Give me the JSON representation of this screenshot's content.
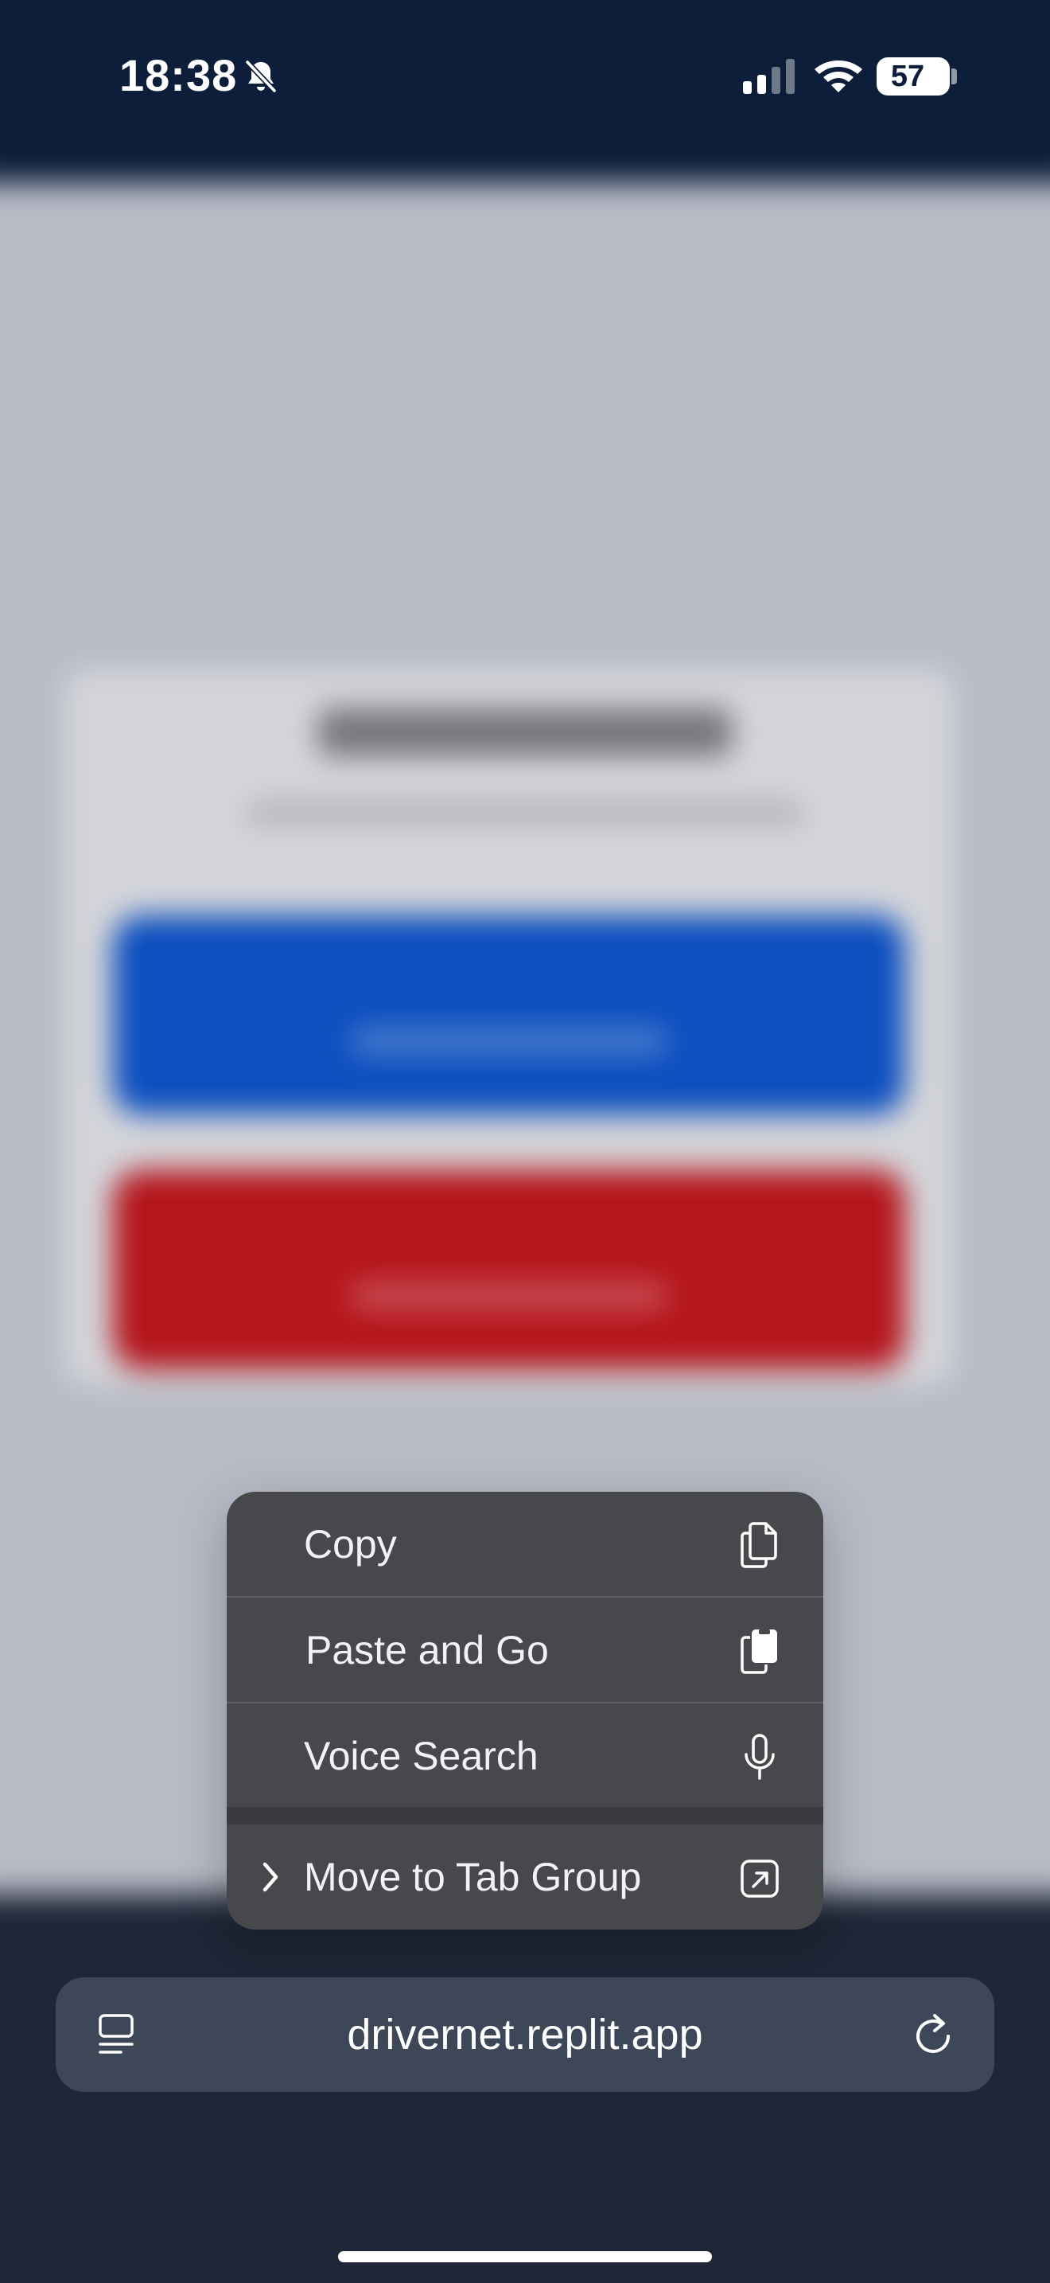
{
  "status_bar": {
    "time": "18:38",
    "battery_level": "57",
    "icons": [
      "bell-slash-icon",
      "cellular-signal-icon",
      "wifi-icon",
      "battery-icon"
    ]
  },
  "context_menu": {
    "items": [
      {
        "label": "Copy",
        "icon": "copy-doc-icon"
      },
      {
        "label": "Paste and Go",
        "icon": "paste-doc-icon"
      },
      {
        "label": "Voice Search",
        "icon": "microphone-icon"
      },
      {
        "label": "Move to Tab Group",
        "icon": "arrow-up-right-square-icon",
        "submenu_indicator": "chevron-right-icon"
      }
    ]
  },
  "address_bar": {
    "url": "drivernet.replit.app",
    "left_icon": "reader-tabs-icon",
    "right_icon": "reload-icon"
  },
  "colors": {
    "status_bar_bg": "#0d1e3a",
    "page_bg": "#b9bcc7",
    "menu_bg": "#47484c",
    "address_bar_bg": "#3e4757",
    "blurred_primary_button": "#0d4fbf",
    "blurred_danger_button": "#b5151c"
  }
}
